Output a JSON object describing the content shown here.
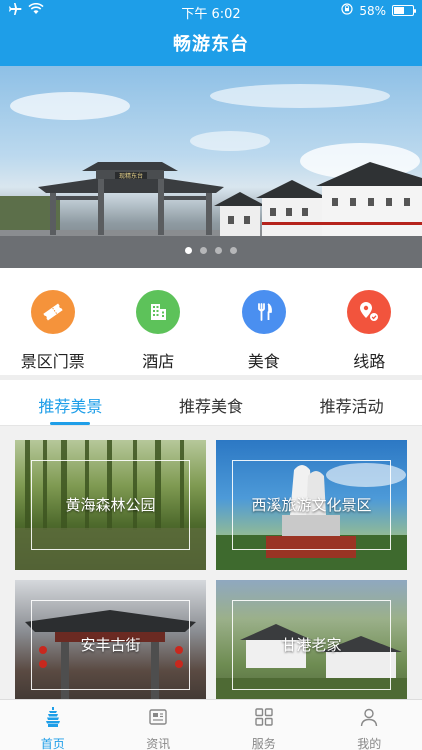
{
  "status_bar": {
    "time": "下午 6:02",
    "battery": "58%",
    "battery_level": 0.58,
    "icons": [
      "airplane-icon",
      "wifi-icon",
      "orientation-lock-icon",
      "battery-icon"
    ]
  },
  "header": {
    "title": "畅游东台"
  },
  "banner": {
    "sign_text": "现精东台",
    "dots": 4,
    "active_dot": 0
  },
  "categories": [
    {
      "label": "景区门票",
      "icon": "ticket-icon",
      "color": "#f5933b"
    },
    {
      "label": "酒店",
      "icon": "hotel-icon",
      "color": "#5dc25a"
    },
    {
      "label": "美食",
      "icon": "fork-knife-icon",
      "color": "#4a8ff0"
    },
    {
      "label": "线路",
      "icon": "route-icon",
      "color": "#f2543d"
    }
  ],
  "tabs": [
    {
      "label": "推荐美景",
      "active": true
    },
    {
      "label": "推荐美食",
      "active": false
    },
    {
      "label": "推荐活动",
      "active": false
    }
  ],
  "cards": [
    {
      "title": "黄海森林公园"
    },
    {
      "title": "西溪旅游文化景区"
    },
    {
      "title": "安丰古街"
    },
    {
      "title": "甘港老家"
    }
  ],
  "bottom_nav": [
    {
      "label": "首页",
      "icon": "pagoda-icon",
      "active": true
    },
    {
      "label": "资讯",
      "icon": "news-icon",
      "active": false
    },
    {
      "label": "服务",
      "icon": "grid-icon",
      "active": false
    },
    {
      "label": "我的",
      "icon": "user-icon",
      "active": false
    }
  ],
  "colors": {
    "primary": "#1e9ee8"
  }
}
